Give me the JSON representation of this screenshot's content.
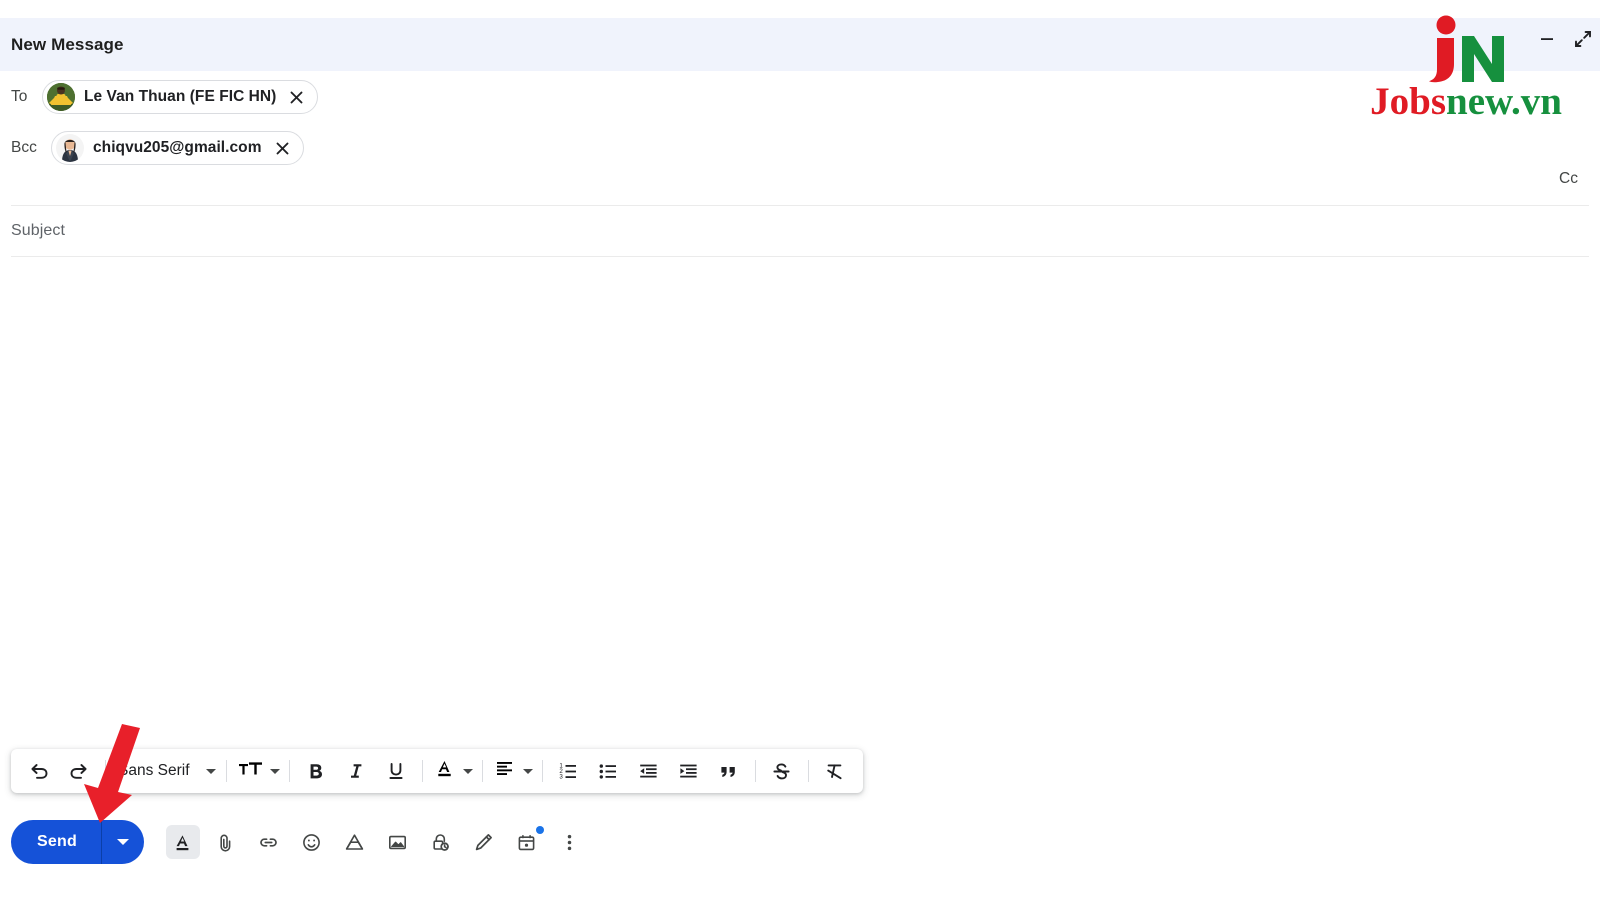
{
  "window": {
    "title": "New Message",
    "controls": [
      {
        "name": "minimize",
        "label": "Minimize",
        "glyph": "minimize-icon"
      },
      {
        "name": "exit-full-screen",
        "label": "Exit full screen",
        "glyph": "exit-full-screen-icon"
      }
    ]
  },
  "brand": {
    "mark": "JN",
    "word_first": "Jobs",
    "word_second": "new.vn",
    "color_red": "#E01B24",
    "color_green": "#16903E"
  },
  "compose": {
    "to": {
      "label": "To",
      "chips": [
        {
          "name": "Le Van Thuan (FE FIC HN)",
          "avatar": "avatar-photo-thuan",
          "remove_label": "Remove"
        }
      ]
    },
    "bcc": {
      "label": "Bcc",
      "chips": [
        {
          "name": "chiqvu205@gmail.com",
          "avatar": "avatar-photo-chiqvu",
          "remove_label": "Remove"
        }
      ]
    },
    "cc_link": "Cc",
    "subject": {
      "placeholder": "Subject",
      "value": ""
    },
    "body": {
      "placeholder": "",
      "value": ""
    }
  },
  "format_toolbar": {
    "undo": "Undo",
    "redo": "Redo",
    "font_family": "Sans Serif",
    "font_size": "Size",
    "bold": "Bold",
    "italic": "Italic",
    "underline": "Underline",
    "text_color": "Text color",
    "align": "Align",
    "numbered_list": "Numbered list",
    "bulleted_list": "Bulleted list",
    "indent_less": "Indent less",
    "indent_more": "Indent more",
    "quote": "Quote",
    "strikethrough": "Strikethrough",
    "remove_formatting": "Remove formatting"
  },
  "action_bar": {
    "send_label": "Send",
    "send_options_label": "More send options",
    "buttons": [
      {
        "name": "formatting-options",
        "label": "Formatting options",
        "icon": "text-format-icon",
        "active": true
      },
      {
        "name": "attach-file",
        "label": "Attach files",
        "icon": "paperclip-icon",
        "active": false
      },
      {
        "name": "insert-link",
        "label": "Insert link",
        "icon": "link-icon",
        "active": false
      },
      {
        "name": "insert-emoji",
        "label": "Insert emoji",
        "icon": "emoji-icon",
        "active": false
      },
      {
        "name": "insert-drive-file",
        "label": "Insert files using Drive",
        "icon": "google-drive-icon",
        "active": false
      },
      {
        "name": "insert-photo",
        "label": "Insert photo",
        "icon": "image-icon",
        "active": false
      },
      {
        "name": "confidential-mode",
        "label": "Toggle confidential mode",
        "icon": "lock-clock-icon",
        "active": false
      },
      {
        "name": "insert-signature",
        "label": "Insert signature",
        "icon": "pen-icon",
        "active": false
      },
      {
        "name": "schedule-send",
        "label": "Schedule send",
        "icon": "calendar-icon",
        "active": false,
        "badge": true
      },
      {
        "name": "more-options",
        "label": "More options",
        "icon": "more-vertical-icon",
        "active": false
      }
    ]
  },
  "annotation": {
    "arrow_color": "#E8202A",
    "points_to": "send-button"
  }
}
